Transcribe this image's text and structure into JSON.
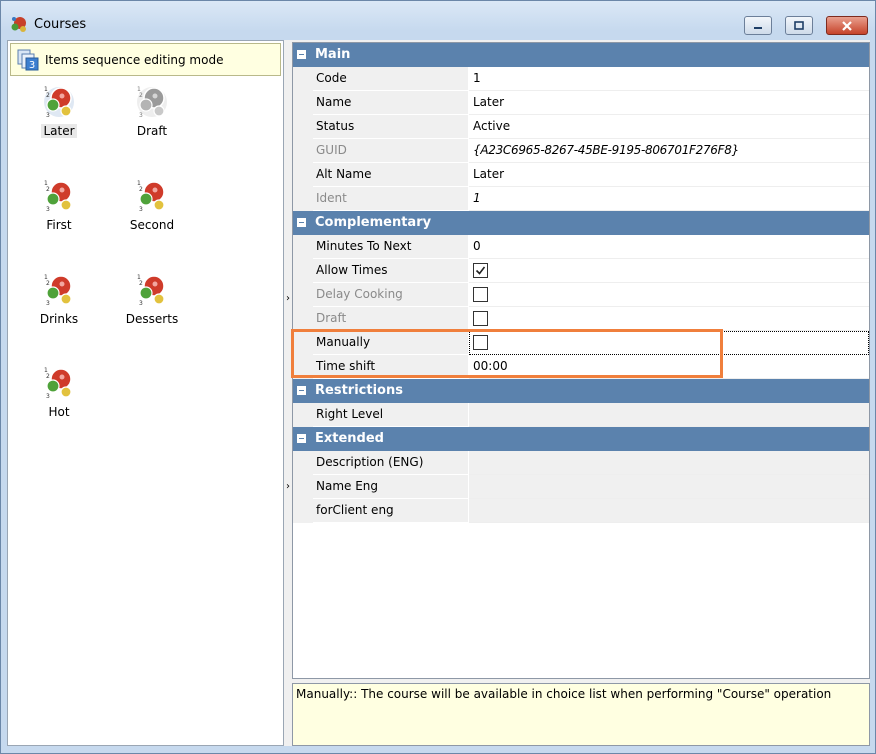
{
  "window": {
    "title": "Courses",
    "icon": "courses-app-icon",
    "title_icon_color": "#c7402a"
  },
  "left_panel": {
    "mode_label": "Items sequence editing mode",
    "mode_icon": "sequence-3-icon",
    "courses": [
      {
        "label": "Later",
        "icon": "course-icon",
        "selected": true
      },
      {
        "label": "Draft",
        "icon": "course-gray-icon",
        "selected": false
      },
      {
        "label": "First",
        "icon": "course-icon",
        "selected": false
      },
      {
        "label": "Second",
        "icon": "course-icon",
        "selected": false
      },
      {
        "label": "Drinks",
        "icon": "course-icon",
        "selected": false
      },
      {
        "label": "Desserts",
        "icon": "course-icon",
        "selected": false
      },
      {
        "label": "Hot",
        "icon": "course-icon",
        "selected": false
      }
    ]
  },
  "properties": {
    "main": {
      "header": "Main",
      "code": {
        "name": "Code",
        "value": "1"
      },
      "name": {
        "name": "Name",
        "value": "Later"
      },
      "status": {
        "name": "Status",
        "value": "Active"
      },
      "guid": {
        "name": "GUID",
        "value": "{A23C6965-8267-45BE-9195-806701F276F8}"
      },
      "alt_name": {
        "name": "Alt Name",
        "value": "Later"
      },
      "ident": {
        "name": "Ident",
        "value": "1"
      }
    },
    "complementary": {
      "header": "Complementary",
      "minutes_to_next": {
        "name": "Minutes To Next",
        "value": "0"
      },
      "allow_times": {
        "name": "Allow Times",
        "checked": true
      },
      "delay_cooking": {
        "name": "Delay Cooking",
        "checked": false
      },
      "draft": {
        "name": "Draft",
        "checked": false
      },
      "manually": {
        "name": "Manually",
        "checked": false
      },
      "time_shift": {
        "name": "Time shift",
        "value": "00:00"
      }
    },
    "restrictions": {
      "header": "Restrictions",
      "right_level": {
        "name": "Right Level",
        "value": ""
      }
    },
    "extended": {
      "header": "Extended",
      "description_eng": {
        "name": "Description (ENG)",
        "value": ""
      },
      "name_eng": {
        "name": "Name Eng",
        "value": ""
      },
      "forclient_eng": {
        "name": "forClient eng",
        "value": ""
      }
    }
  },
  "description": "Manually:: The course will be available in choice list when performing \"Course\" operation",
  "colors": {
    "category_header": "#5b82ad",
    "highlight": "#f07f3c",
    "tooltip_bg": "#ffffe1"
  }
}
